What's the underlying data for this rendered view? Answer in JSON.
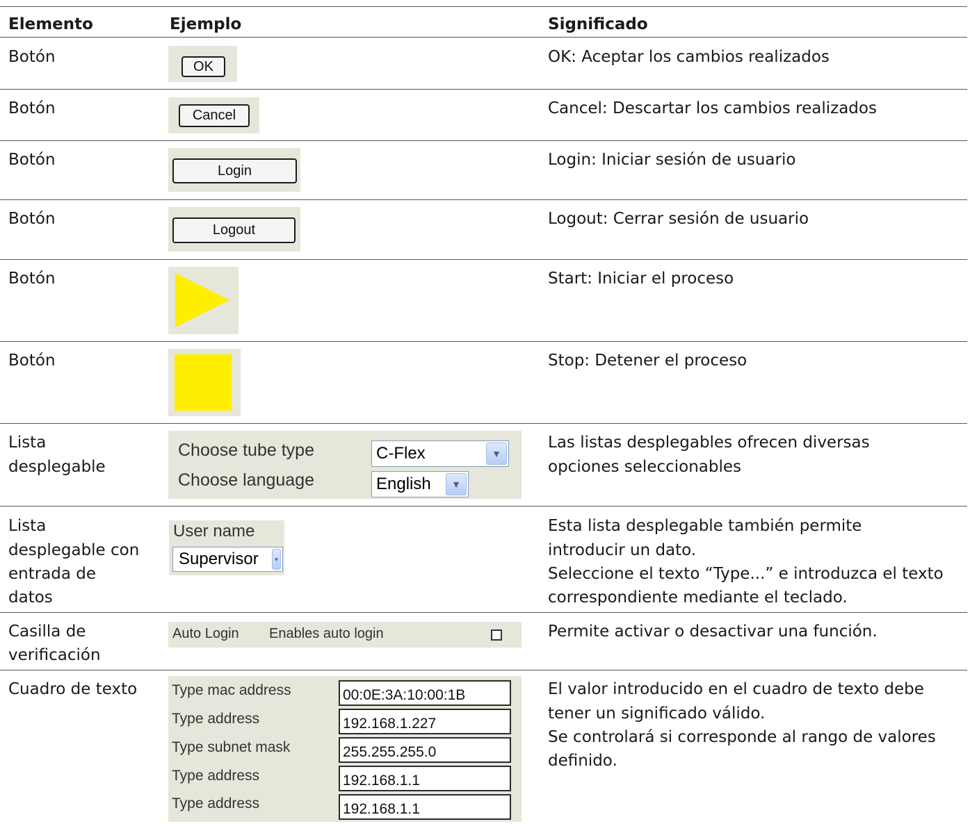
{
  "headers": {
    "elemento": "Elemento",
    "ejemplo": "Ejemplo",
    "significado": "Significado"
  },
  "rows": [
    {
      "element": "Botón",
      "meaning": "OK: Aceptar los cambios realizados",
      "button": "OK"
    },
    {
      "element": "Botón",
      "meaning": "Cancel: Descartar los cambios realizados",
      "button": "Cancel"
    },
    {
      "element": "Botón",
      "meaning": "Login: Iniciar sesión de usuario",
      "button": "Login"
    },
    {
      "element": "Botón",
      "meaning": "Logout: Cerrar sesión de usuario",
      "button": "Logout"
    },
    {
      "element": "Botón",
      "meaning": "Start: Iniciar el proceso",
      "icon": "play-triangle-icon",
      "color": "#ffee00"
    },
    {
      "element": "Botón",
      "meaning": "Stop: Detener el proceso",
      "icon": "stop-square-icon",
      "color": "#ffee00"
    },
    {
      "element_lines": [
        "Lista",
        "desplegable"
      ],
      "meaning_lines": [
        "Las listas desplegables ofrecen diversas",
        "opciones seleccionables"
      ],
      "example": {
        "tube_label": "Choose tube type",
        "tube_value": "C-Flex",
        "lang_label": "Choose language",
        "lang_value": "English"
      }
    },
    {
      "element_lines": [
        "Lista",
        "desplegable con",
        "entrada de",
        "datos"
      ],
      "meaning_lines": [
        "Esta lista desplegable también permite",
        "introducir un dato.",
        "Seleccione el texto “Type...” e introduzca el texto",
        "correspondiente mediante el teclado."
      ],
      "example": {
        "label": "User name",
        "value": "Supervisor"
      }
    },
    {
      "element_lines": [
        "Casilla de",
        "verificación"
      ],
      "meaning": "Permite activar o desactivar una función.",
      "example": {
        "label": "Auto Login",
        "desc": "Enables auto login",
        "checked": false
      }
    },
    {
      "element": "Cuadro de texto",
      "meaning_lines": [
        "El valor introducido en el cuadro de texto debe",
        "tener un significado válido.",
        "Se controlará si corresponde al rango de valores",
        "definido."
      ],
      "example": {
        "fields": [
          {
            "label": "Type mac address",
            "value": "00:0E:3A:10:00:1B"
          },
          {
            "label": "Type address",
            "value": "192.168.1.227"
          },
          {
            "label": "Type subnet mask",
            "value": "255.255.255.0"
          },
          {
            "label": "Type address",
            "value": "192.168.1.1"
          },
          {
            "label": "Type address",
            "value": "192.168.1.1"
          }
        ]
      }
    }
  ]
}
